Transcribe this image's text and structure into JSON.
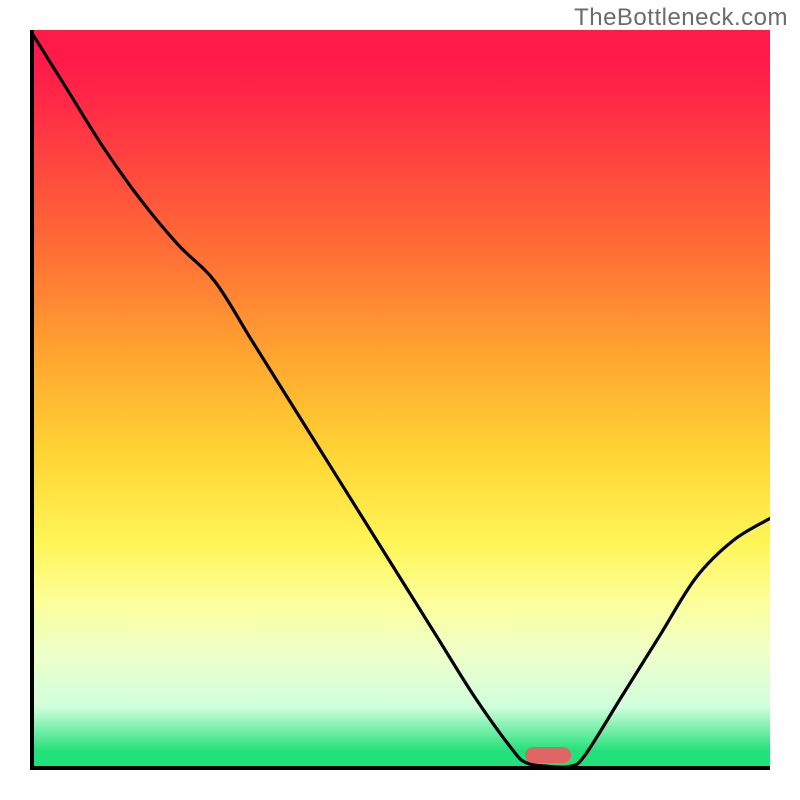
{
  "watermark": "TheBottleneck.com",
  "chart_data": {
    "type": "line",
    "title": "",
    "xlabel": "",
    "ylabel": "",
    "xlim": [
      0,
      100
    ],
    "ylim": [
      0,
      100
    ],
    "x": [
      0,
      5,
      10,
      15,
      20,
      25,
      30,
      35,
      40,
      45,
      50,
      55,
      60,
      65,
      67,
      70,
      73,
      75,
      80,
      85,
      90,
      95,
      100
    ],
    "y": [
      100,
      92,
      84,
      77,
      71,
      66,
      58,
      50,
      42,
      34,
      26,
      18,
      10,
      3,
      1,
      0.5,
      0.5,
      2,
      10,
      18,
      26,
      31,
      34
    ],
    "marker": {
      "x": 70,
      "y": 2
    },
    "gradient_note": "vertical gradient red→orange→yellow→green from top to bottom"
  }
}
